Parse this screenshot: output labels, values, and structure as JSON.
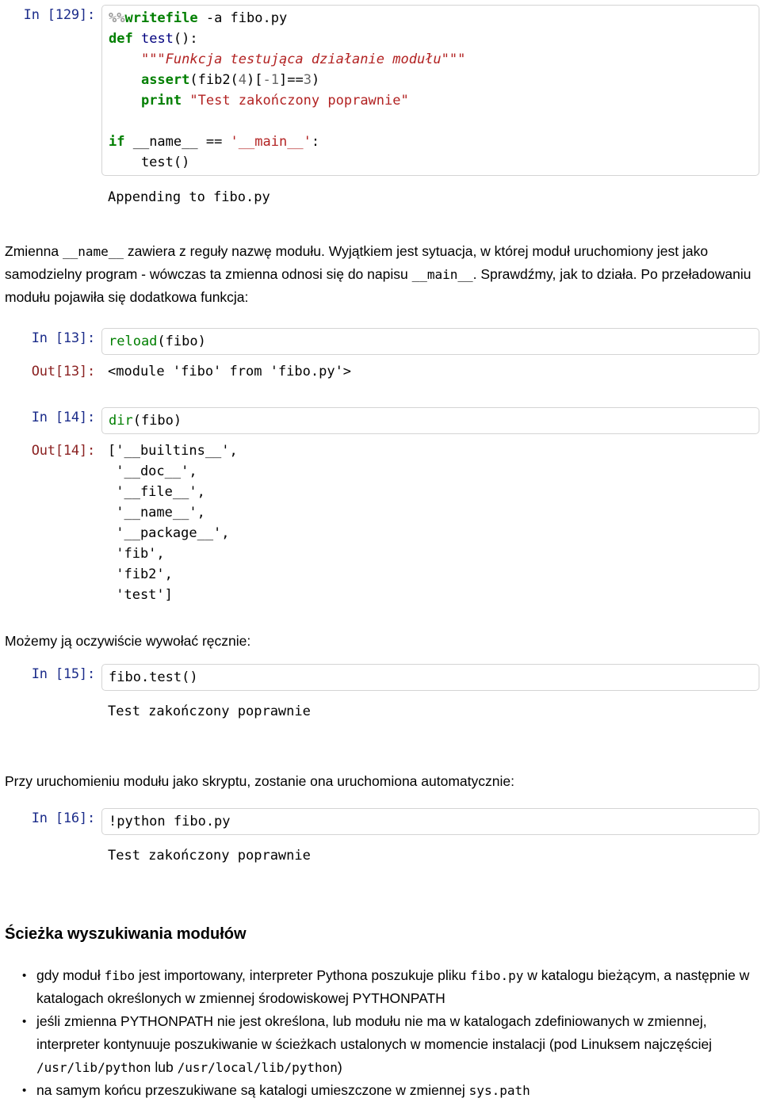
{
  "document": {
    "kind": "jupyter-notebook-export",
    "language": "pl"
  },
  "cells": [
    {
      "id": "cell-writefile",
      "type": "code",
      "prompt_in": "In [129]:",
      "source_lines": [
        "%%writefile -a fibo.py",
        "def test():",
        "    \"\"\"Funkcja testująca działanie modułu\"\"\"",
        "    assert(fib2(4)[-1]==3)",
        "    print \"Test zakończony poprawnie\"",
        "",
        "if __name__ == '__main__':",
        "    test()"
      ],
      "stream_output": "Appending to fibo.py"
    },
    {
      "id": "cell-reload",
      "type": "code",
      "prompt_in": "In [13]:",
      "prompt_out": "Out[13]:",
      "source": "reload(fibo)",
      "result": "<module 'fibo' from 'fibo.py'>"
    },
    {
      "id": "cell-dir",
      "type": "code",
      "prompt_in": "In [14]:",
      "prompt_out": "Out[14]:",
      "source": "dir(fibo)",
      "result_lines": [
        "['__builtins__',",
        " '__doc__',",
        " '__file__',",
        " '__name__',",
        " '__package__',",
        " 'fib',",
        " 'fib2',",
        " 'test']"
      ]
    },
    {
      "id": "cell-test",
      "type": "code",
      "prompt_in": "In [15]:",
      "source": "fibo.test()",
      "stream_output": "Test zakończony poprawnie"
    },
    {
      "id": "cell-python-script",
      "type": "code",
      "prompt_in": "In [16]:",
      "source": "!python fibo.py",
      "stream_output": "Test zakończony poprawnie"
    }
  ],
  "prose": {
    "paragraph_name": {
      "part1": "Zmienna ",
      "code1": "__name__",
      "part2": " zawiera z reguły nazwę modułu. Wyjątkiem jest sytuacja, w której moduł uruchomiony jest jako samodzielny program - wówczas ta zmienna odnosi się do napisu ",
      "code2": "__main__",
      "part3": ". Sprawdźmy, jak to działa. Po przeładowaniu modułu pojawiła się dodatkowa funkcja:"
    },
    "paragraph_manual": "Możemy ją oczywiście wywołać ręcznie:",
    "paragraph_script": "Przy uruchomieniu modułu jako skryptu, zostanie ona uruchomiona automatycznie:"
  },
  "section": {
    "heading": "Ścieżka wyszukiwania modułów",
    "bullets": [
      {
        "id": "bullet-import-lookup",
        "segments": [
          {
            "t": "gdy moduł ",
            "mono": false
          },
          {
            "t": "fibo",
            "mono": true
          },
          {
            "t": " jest importowany, interpreter Pythona poszukuje pliku ",
            "mono": false
          },
          {
            "t": "fibo.py",
            "mono": true
          },
          {
            "t": " w katalogu bieżącym, a następnie w katalogach określonych w zmiennej środowiskowej PYTHONPATH",
            "mono": false
          }
        ]
      },
      {
        "id": "bullet-pythonpath-fallback",
        "segments": [
          {
            "t": "jeśli zmienna PYTHONPATH nie jest określona, lub modułu nie ma w katalogach zdefiniowanych w zmiennej, interpreter kontynuuje poszukiwanie w ścieżkach ustalonych w momencie instalacji (pod Linuksem najczęściej ",
            "mono": false
          },
          {
            "t": "/usr/lib/python",
            "mono": true
          },
          {
            "t": " lub ",
            "mono": false
          },
          {
            "t": "/usr/local/lib/python",
            "mono": true
          },
          {
            "t": ")",
            "mono": false
          }
        ]
      },
      {
        "id": "bullet-syspath",
        "segments": [
          {
            "t": "na samym końcu przeszukiwane są katalogi umieszczone w zmiennej ",
            "mono": false
          },
          {
            "t": "sys.path",
            "mono": true
          }
        ]
      }
    ]
  },
  "colors": {
    "prompt_in": "#1b2c8a",
    "prompt_out": "#8b2222",
    "keyword": "#007f00",
    "function_name": "#00007f",
    "string": "#b22222",
    "number": "#666666",
    "cell_border": "#d4d4d4",
    "background": "#ffffff"
  }
}
